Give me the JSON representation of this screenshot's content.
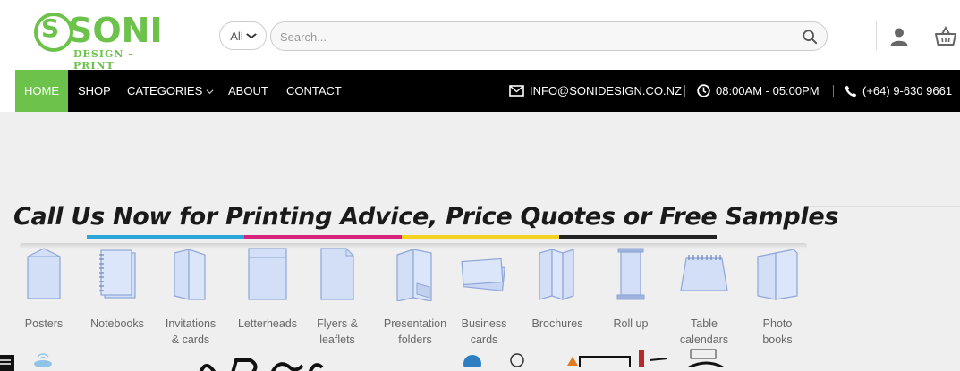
{
  "header": {
    "logo_text": "SONI",
    "logo_sub": "DESIGN - PRINT",
    "category_select": "All",
    "search_placeholder": "Search..."
  },
  "nav": {
    "items": [
      {
        "label": "HOME",
        "active": true
      },
      {
        "label": "SHOP"
      },
      {
        "label": "CATEGORIES"
      },
      {
        "label": "ABOUT"
      },
      {
        "label": "CONTACT"
      }
    ],
    "email": "INFO@SONIDESIGN.CO.NZ",
    "hours": "08:00AM - 05:00PM",
    "phone": "(+64) 9-630 9661"
  },
  "banner": {
    "headline": "Call Us Now for Printing Advice, Price Quotes or Free Samples",
    "products": [
      {
        "line1": "Posters",
        "line2": ""
      },
      {
        "line1": "Notebooks",
        "line2": ""
      },
      {
        "line1": "Invitations",
        "line2": "& cards"
      },
      {
        "line1": "Letterheads",
        "line2": ""
      },
      {
        "line1": "Flyers &",
        "line2": "leaflets"
      },
      {
        "line1": "Presentation",
        "line2": "folders"
      },
      {
        "line1": "Business",
        "line2": "cards"
      },
      {
        "line1": "Brochures",
        "line2": ""
      },
      {
        "line1": "Roll up",
        "line2": ""
      },
      {
        "line1": "Table",
        "line2": "calendars"
      },
      {
        "line1": "Photo",
        "line2": "books"
      }
    ],
    "underline_colors": [
      "#2aa7d8",
      "#d6247d",
      "#f4d21f",
      "#222222"
    ]
  },
  "colors": {
    "brand_green": "#6cc24a",
    "nav_bg": "#000000",
    "icon_fill": "#d3def7",
    "icon_stroke": "#8ea6d6"
  }
}
